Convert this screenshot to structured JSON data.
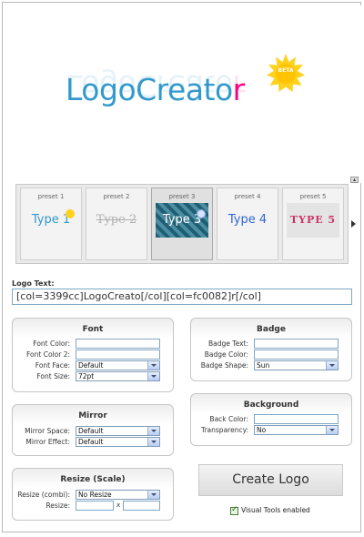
{
  "preview": {
    "logo_main": "LogoCreato",
    "logo_last": "r",
    "badge_text": "BETA"
  },
  "presets": [
    {
      "label": "preset 1",
      "thumb_text": "Type 1",
      "thumb_color": "#3399cc"
    },
    {
      "label": "preset 2",
      "thumb_text": "Type 2",
      "thumb_color": "#aaaaaa"
    },
    {
      "label": "preset 3",
      "thumb_text": "Type 3",
      "thumb_color": "#ffffff"
    },
    {
      "label": "preset 4",
      "thumb_text": "Type 4",
      "thumb_color": "#3366cc"
    },
    {
      "label": "preset 5",
      "thumb_text": "TYPE 5",
      "thumb_color": "#cc3366"
    }
  ],
  "logo_text": {
    "label": "Logo Text:",
    "value": "[col=3399cc]LogoCreato[/col][col=fc0082]r[/col]"
  },
  "font_panel": {
    "title": "Font",
    "font_color_label": "Font Color:",
    "font_color2_label": "Font Color 2:",
    "font_face_label": "Font Face:",
    "font_face_value": "Default",
    "font_size_label": "Font Size:",
    "font_size_value": "72pt"
  },
  "mirror_panel": {
    "title": "Mirror",
    "space_label": "Mirror Space:",
    "space_value": "Default",
    "effect_label": "Mirror Effect:",
    "effect_value": "Default"
  },
  "resize_panel": {
    "title": "Resize (Scale)",
    "combi_label": "Resize (combi):",
    "combi_value": "No Resize",
    "resize_label": "Resize:",
    "x_sep": "x"
  },
  "badge_panel": {
    "title": "Badge",
    "text_label": "Badge Text:",
    "color_label": "Badge Color:",
    "shape_label": "Badge Shape:",
    "shape_value": "Sun"
  },
  "background_panel": {
    "title": "Background",
    "back_color_label": "Back Color:",
    "transparency_label": "Transparency:",
    "transparency_value": "No"
  },
  "actions": {
    "create_label": "Create Logo",
    "visual_tools_label": "Visual Tools enabled"
  },
  "colors": {
    "logo_blue": "#3399cc",
    "logo_pink": "#fc0082",
    "badge_yellow": "#ffd21e"
  }
}
